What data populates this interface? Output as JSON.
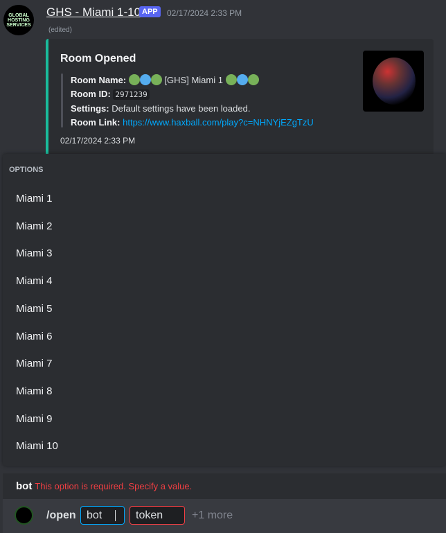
{
  "message": {
    "avatar_text": "GLOBAL HOSTING SERVICES",
    "author": "GHS - Miami 1-10",
    "badge": "APP",
    "timestamp": "02/17/2024 2:33 PM",
    "edited": "(edited)"
  },
  "embed": {
    "color": "#1abc9c",
    "title": "Room Opened",
    "room_name_label": "Room Name:",
    "room_name": "[GHS] Miami 1",
    "room_id_label": "Room ID:",
    "room_id": "2971239",
    "settings_label": "Settings:",
    "settings": "Default settings have been loaded.",
    "room_link_label": "Room Link:",
    "room_link": "https://www.haxball.com/play?c=NHNYjEZgTzU",
    "footer": "02/17/2024 2:33 PM"
  },
  "options": {
    "header": "OPTIONS",
    "items": [
      "Miami 1",
      "Miami 2",
      "Miami 3",
      "Miami 4",
      "Miami 5",
      "Miami 6",
      "Miami 7",
      "Miami 8",
      "Miami 9",
      "Miami 10"
    ]
  },
  "error": {
    "option": "bot",
    "message": "This option is required. Specify a value."
  },
  "input": {
    "command": "/open",
    "params": [
      "bot",
      "token"
    ],
    "more": "+1 more"
  },
  "colors": {
    "error": "#f23f43",
    "active_border": "#00a8fc",
    "link": "#00a8fc"
  }
}
